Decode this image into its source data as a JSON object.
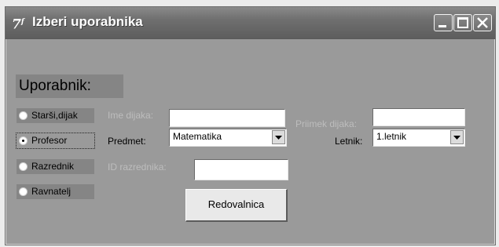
{
  "window": {
    "title": "Izberi uporabnika",
    "app_icon": "tk-feather-icon",
    "controls": [
      "minimize-icon",
      "maximize-icon",
      "close-icon"
    ]
  },
  "heading": "Uporabnik:",
  "user_types": [
    {
      "label": "Starši,dijak",
      "checked": false
    },
    {
      "label": "Profesor",
      "checked": true
    },
    {
      "label": "Razrednik",
      "checked": false
    },
    {
      "label": "Ravnatelj",
      "checked": false
    }
  ],
  "form": {
    "ime_dijaka_label": "Ime dijaka:",
    "ime_dijaka_value": "",
    "priimek_dijaka_label": "Priimek dijaka:",
    "priimek_dijaka_value": "",
    "predmet_label": "Predmet:",
    "predmet_value": "Matematika",
    "letnik_label": "Letnik:",
    "letnik_value": "1.letnik",
    "id_razrednika_label": "ID razrednika:",
    "id_razrednika_value": ""
  },
  "actions": {
    "submit_label": "Redovalnica"
  }
}
